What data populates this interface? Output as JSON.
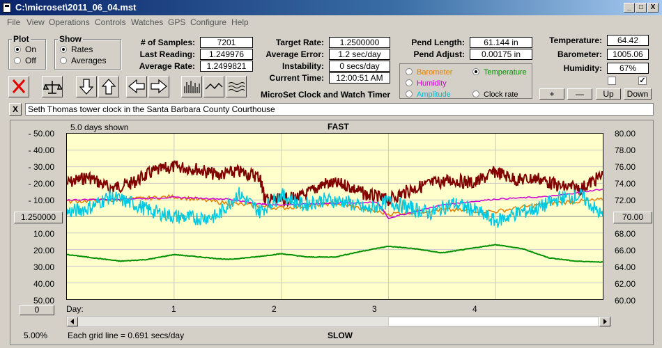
{
  "window": {
    "title": "C:\\microset\\2011_06_04.mst",
    "min": "_",
    "max": "□",
    "close": "X"
  },
  "menu": [
    "File",
    "View",
    "Operations",
    "Controls",
    "Watches",
    "GPS",
    "Configure",
    "Help"
  ],
  "plot_group": {
    "legend": "Plot",
    "on": "On",
    "off": "Off",
    "selected": "On"
  },
  "show_group": {
    "legend": "Show",
    "rates": "Rates",
    "averages": "Averages",
    "selected": "Rates"
  },
  "stats": {
    "samples_label": "# of Samples:",
    "samples": "7201",
    "last_reading_label": "Last Reading:",
    "last_reading": "1.249976",
    "average_rate_label": "Average Rate:",
    "average_rate": "1.2499821",
    "target_rate_label": "Target Rate:",
    "target_rate": "1.2500000",
    "average_error_label": "Average Error:",
    "average_error": "1.2 sec/day",
    "instability_label": "Instability:",
    "instability": "0 secs/day",
    "current_time_label": "Current Time:",
    "current_time": "12:00:51 AM",
    "pend_length_label": "Pend Length:",
    "pend_length": "61.144 in",
    "pend_adjust_label": "Pend Adjust:",
    "pend_adjust": "0.00175 in",
    "temperature_label": "Temperature:",
    "temperature": "64.42",
    "barometer_label": "Barometer:",
    "barometer": "1005.06",
    "humidity_label": "Humidity:",
    "humidity": "67%"
  },
  "app_caption": "MicroSet Clock and Watch Timer",
  "options": {
    "barometer": "Barometer",
    "temperature": "Temperature",
    "humidity": "Humidity",
    "amplitude": "Amplitude",
    "clock_rate": "Clock rate",
    "selected": "Temperature",
    "colors": {
      "barometer": "#e08000",
      "temperature": "#009000",
      "humidity": "#d000d0",
      "amplitude": "#00c8e0",
      "clock_rate": "#000000"
    }
  },
  "scale_buttons": {
    "plus": "+",
    "minus": "—",
    "up": "Up",
    "down": "Down"
  },
  "checks": {
    "left": "",
    "right": "✓"
  },
  "description": "Seth Thomas tower clock in the Santa Barbara County Courthouse",
  "clear_button": "X",
  "graph": {
    "days_shown": "5.0 days shown",
    "fast": "FAST",
    "slow": "SLOW",
    "left_axis": [
      "- 50.00",
      "- 40.00",
      "- 30.00",
      "- 20.00",
      "- 10.00",
      "",
      "10.00",
      "20.00",
      "30.00",
      "40.00",
      "50.00"
    ],
    "right_axis": [
      "80.00",
      "78.00",
      "76.00",
      "74.00",
      "72.00",
      "",
      "68.00",
      "66.00",
      "64.00",
      "62.00",
      "60.00"
    ],
    "center_left": "1.250000",
    "center_right": "70.00",
    "x_start": "Day:",
    "x_labels": [
      "1",
      "2",
      "3",
      "4"
    ],
    "bottom_left_button": "0",
    "zoom": "5.00%",
    "grid_note": "Each grid line = 0.691 secs/day"
  },
  "chart_data": {
    "type": "line",
    "x_unit": "days",
    "xlim": [
      0,
      5
    ],
    "ylim_left": [
      -50,
      50
    ],
    "ylim_right": [
      60,
      80
    ],
    "series": [
      {
        "axis": "left",
        "color": "#800000",
        "x": [
          0,
          0.2,
          0.4,
          0.6,
          0.8,
          1.0,
          1.2,
          1.4,
          1.6,
          1.8,
          1.85,
          2.0,
          2.2,
          2.4,
          2.6,
          2.8,
          3.0,
          3.2,
          3.4,
          3.6,
          3.8,
          4.0,
          4.2,
          4.4,
          4.6,
          4.8,
          5.0
        ],
        "y": [
          -20,
          -24,
          -17,
          -20,
          -27,
          -30,
          -29,
          -25,
          -27,
          -24,
          -10,
          -10,
          -12,
          -20,
          -19,
          -13,
          -10,
          -16,
          -20,
          -22,
          -20,
          -27,
          -22,
          -23,
          -18,
          -17,
          -25
        ]
      },
      {
        "axis": "right",
        "color": "#e08000",
        "x": [
          0,
          0.5,
          1.0,
          1.5,
          2.0,
          2.5,
          3.0,
          3.5,
          4.0,
          4.5,
          5.0
        ],
        "y": [
          71.8,
          72.0,
          72.4,
          71.6,
          71.0,
          71.6,
          70.3,
          70.8,
          70.6,
          71.6,
          72.0
        ]
      },
      {
        "axis": "right",
        "color": "#d000d0",
        "x": [
          0,
          0.5,
          1.0,
          1.5,
          1.8,
          2.0,
          2.5,
          2.9,
          3.0,
          3.5,
          4.0,
          4.5,
          5.0
        ],
        "y": [
          72.0,
          72.1,
          72.3,
          72.1,
          71.5,
          71.4,
          71.6,
          71.7,
          69.8,
          71.4,
          72.1,
          72.4,
          73.3
        ]
      },
      {
        "axis": "right",
        "color": "#00c8e0",
        "x": [
          0,
          0.2,
          0.4,
          0.6,
          0.8,
          1.0,
          1.2,
          1.4,
          1.6,
          1.8,
          2.0,
          2.2,
          2.4,
          2.6,
          2.8,
          3.0,
          3.2,
          3.4,
          3.6,
          3.8,
          4.0,
          4.2,
          4.4,
          4.6,
          4.8,
          5.0
        ],
        "y": [
          70.5,
          71.0,
          72.4,
          71.6,
          70.6,
          70.0,
          69.8,
          70.0,
          72.8,
          70.6,
          72.6,
          71.4,
          72.0,
          71.8,
          70.8,
          71.8,
          71.0,
          70.4,
          71.6,
          70.8,
          69.4,
          70.4,
          71.0,
          72.2,
          72.5,
          70.0
        ]
      },
      {
        "axis": "right",
        "color": "#009000",
        "x": [
          0,
          0.25,
          0.5,
          0.75,
          1.0,
          1.25,
          1.5,
          1.75,
          2.0,
          2.25,
          2.5,
          2.75,
          3.0,
          3.25,
          3.5,
          3.75,
          4.0,
          4.25,
          4.5,
          4.75,
          5.0
        ],
        "y": [
          65.4,
          65.0,
          64.6,
          64.8,
          65.4,
          65.1,
          64.8,
          65.1,
          65.5,
          65.1,
          65.1,
          65.8,
          66.4,
          66.1,
          65.6,
          66.1,
          66.6,
          66.1,
          65.0,
          64.6,
          64.5
        ]
      }
    ]
  }
}
